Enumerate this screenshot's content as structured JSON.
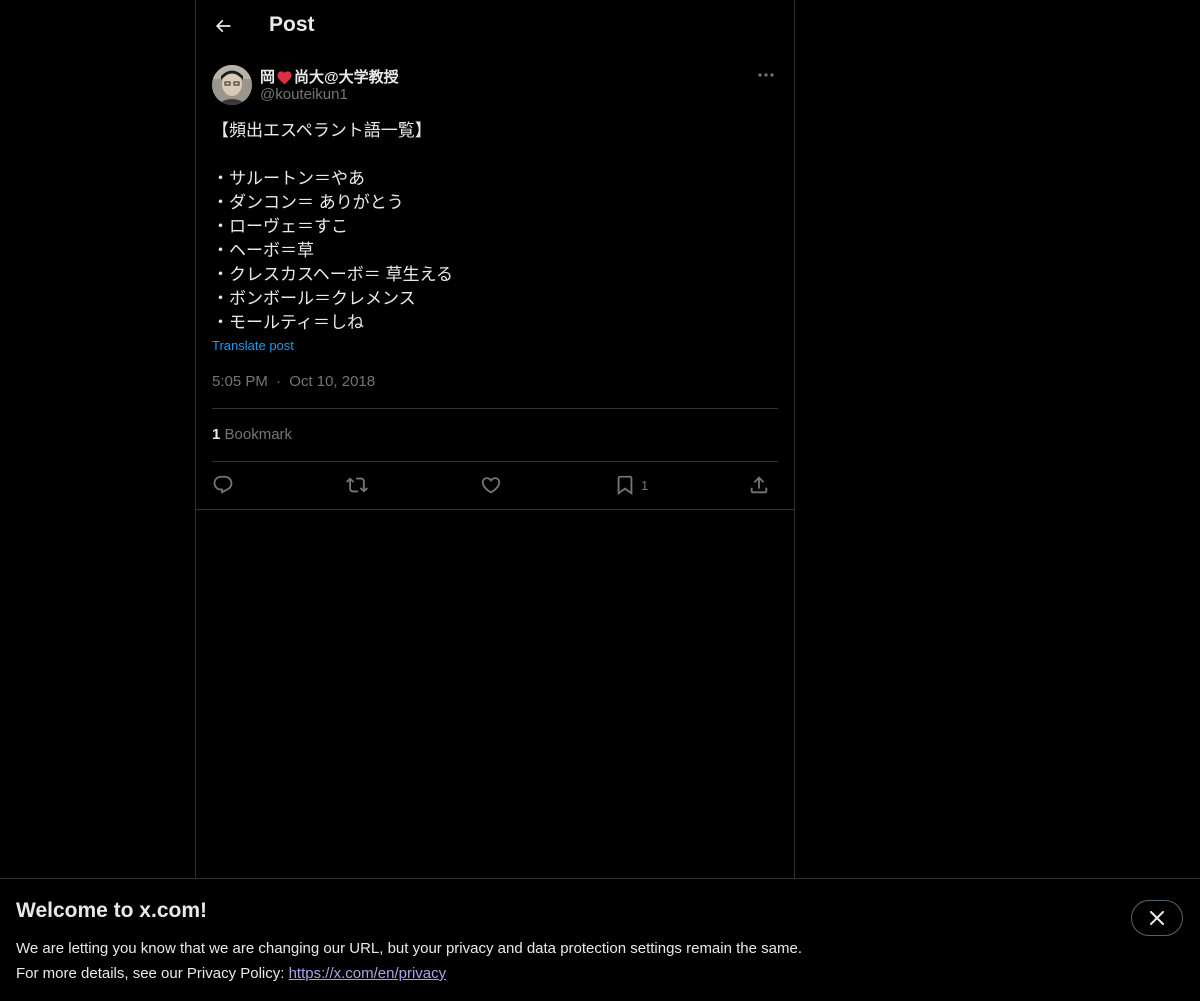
{
  "header": {
    "back_icon": "arrow-left-icon",
    "title": "Post"
  },
  "post": {
    "author": {
      "name_part1": "岡",
      "name_emoji_icon": "red-heart-icon",
      "name_part2": "尚大@大学教授",
      "handle": "@kouteikun1"
    },
    "body_lines": [
      "【頻出エスペラント語一覧】",
      "",
      "・サルートン＝やあ",
      "・ダンコン＝ ありがとう",
      "・ローヴェ＝すこ",
      "・ヘーボ＝草",
      "・クレスカスヘーボ＝ 草生える",
      "・ボンボール＝クレメンス",
      "・モールティ＝しね"
    ],
    "translate_label": "Translate post",
    "time": "5:05 PM",
    "separator": "·",
    "date": "Oct 10, 2018",
    "bookmark_count": "1",
    "bookmark_label": "Bookmark",
    "actions": {
      "bookmark_count": "1"
    }
  },
  "banner": {
    "title": "Welcome to x.com!",
    "line1": "We are letting you know that we are changing our URL, but your privacy and data protection settings remain the same.",
    "line2_prefix": "For more details, see our Privacy Policy: ",
    "link": "https://x.com/en/privacy"
  },
  "colors": {
    "background": "#000000",
    "text": "#e7e9ea",
    "muted": "#71767b",
    "link": "#1d9bf0",
    "heart": "#e0245e",
    "border": "#2f3336"
  }
}
